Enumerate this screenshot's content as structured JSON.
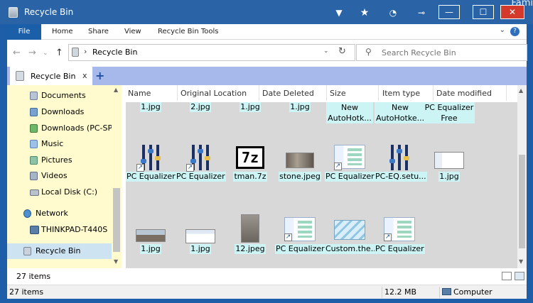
{
  "window": {
    "title": "Recycle Bin",
    "corner_label": "Fami",
    "minimize": "—",
    "maximize": "☐",
    "close": "✕"
  },
  "ribbon": {
    "tabs": [
      "File",
      "Home",
      "Share",
      "View",
      "Recycle Bin Tools"
    ],
    "help": "?"
  },
  "address": {
    "path": "Recycle Bin",
    "search_placeholder": "Search Recycle Bin"
  },
  "tab": {
    "label": "Recycle Bin",
    "close": "x",
    "add": "+"
  },
  "nav": {
    "items": [
      {
        "label": "Documents",
        "icon": "documents-icon"
      },
      {
        "label": "Downloads",
        "icon": "downloads-icon"
      },
      {
        "label": "Downloads (PC-SPE",
        "icon": "downloads-icon"
      },
      {
        "label": "Music",
        "icon": "music-icon"
      },
      {
        "label": "Pictures",
        "icon": "pictures-icon"
      },
      {
        "label": "Videos",
        "icon": "videos-icon"
      },
      {
        "label": "Local Disk (C:)",
        "icon": "disk-icon"
      },
      {
        "label": "Network",
        "icon": "network-icon"
      },
      {
        "label": "THINKPAD-T440S",
        "icon": "computer-icon"
      },
      {
        "label": "Recycle Bin",
        "icon": "recycle-bin-icon"
      }
    ]
  },
  "columns": [
    "Name",
    "Original Location",
    "Date Deleted",
    "Size",
    "Item type",
    "Date modified"
  ],
  "items": {
    "row0": [
      {
        "name": "1.jpg"
      },
      {
        "name": "2.jpg"
      },
      {
        "name": "1.jpg"
      },
      {
        "name": "1.jpg"
      },
      {
        "line1": "New",
        "line2": "AutoHotk..."
      },
      {
        "line1": "New",
        "line2": "AutoHotke..."
      },
      {
        "line1": "PC Equalizer",
        "line2": "Free"
      }
    ],
    "row1": [
      {
        "name": "PC Equalizer",
        "kind": "eq-shortcut"
      },
      {
        "name": "PC Equalizer",
        "kind": "eq-shortcut"
      },
      {
        "name": "tman.7z",
        "kind": "7z"
      },
      {
        "name": "stone.jpeg",
        "kind": "photo"
      },
      {
        "name": "PC Equalizer",
        "kind": "win-shortcut"
      },
      {
        "name": "PC-EQ.setu...",
        "kind": "eq"
      },
      {
        "name": "1.jpg",
        "kind": "screenshot"
      }
    ],
    "row2": [
      {
        "name": "1.jpg",
        "kind": "panorama"
      },
      {
        "name": "1.jpg",
        "kind": "screenshot"
      },
      {
        "name": "12.jpeg",
        "kind": "stone"
      },
      {
        "name": "PC Equalizer",
        "kind": "win-shortcut"
      },
      {
        "name": "Custom.the...",
        "kind": "theme"
      },
      {
        "name": "PC Equalizer",
        "kind": "win-shortcut"
      }
    ]
  },
  "countbar": {
    "label": "27 items"
  },
  "statusbar": {
    "items": "27 items",
    "size": "12.2 MB",
    "location": "Computer"
  },
  "colors": {
    "titlebar": "#2a64a6",
    "file_tab": "#1a5fa8",
    "nav_bg": "#fffbcf",
    "content_bg": "#d8d8d8",
    "label_highlight": "#ccf4f4",
    "tabstrip": "#a7b9ea"
  }
}
